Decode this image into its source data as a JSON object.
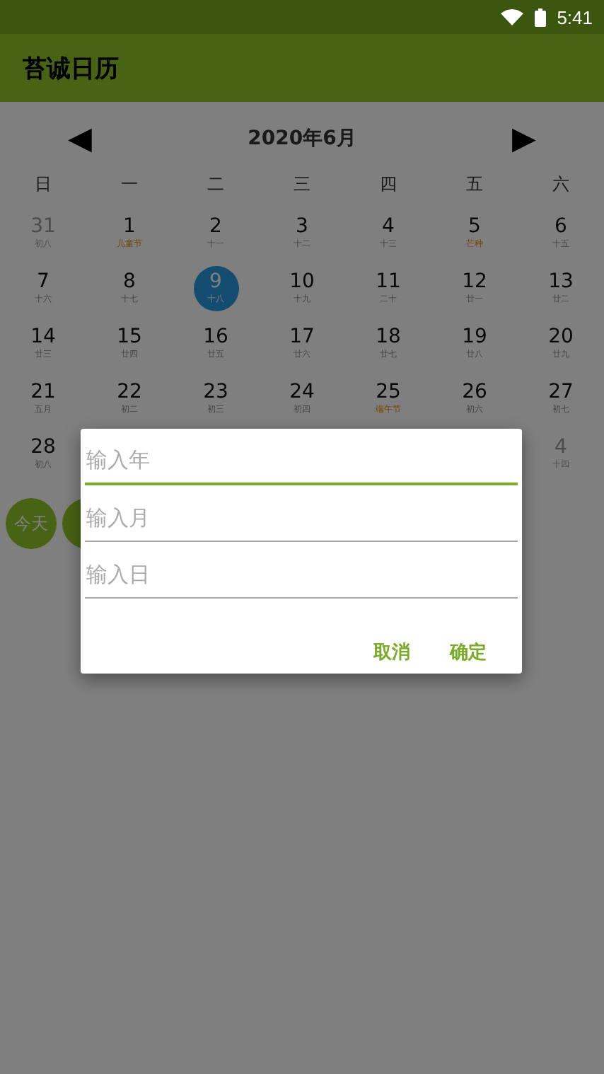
{
  "status_bar": {
    "time": "5:41"
  },
  "app_bar": {
    "title": "苔诚日历"
  },
  "calendar": {
    "month_title": "2020年6月",
    "prev": "◀",
    "next": "▶",
    "weekdays": [
      "日",
      "一",
      "二",
      "三",
      "四",
      "五",
      "六"
    ],
    "hidden_span_last_week": true,
    "weeks": [
      [
        {
          "day": "31",
          "lunar": "初八",
          "other_month": true,
          "festival": false,
          "selected": false
        },
        {
          "day": "1",
          "lunar": "儿童节",
          "other_month": false,
          "festival": true,
          "selected": false
        },
        {
          "day": "2",
          "lunar": "十一",
          "other_month": false,
          "festival": false,
          "selected": false
        },
        {
          "day": "3",
          "lunar": "十二",
          "other_month": false,
          "festival": false,
          "selected": false
        },
        {
          "day": "4",
          "lunar": "十三",
          "other_month": false,
          "festival": false,
          "selected": false
        },
        {
          "day": "5",
          "lunar": "芒种",
          "other_month": false,
          "festival": true,
          "selected": false
        },
        {
          "day": "6",
          "lunar": "十五",
          "other_month": false,
          "festival": false,
          "selected": false
        }
      ],
      [
        {
          "day": "7",
          "lunar": "十六",
          "other_month": false,
          "festival": false,
          "selected": false
        },
        {
          "day": "8",
          "lunar": "十七",
          "other_month": false,
          "festival": false,
          "selected": false
        },
        {
          "day": "9",
          "lunar": "十八",
          "other_month": false,
          "festival": false,
          "selected": true
        },
        {
          "day": "10",
          "lunar": "十九",
          "other_month": false,
          "festival": false,
          "selected": false
        },
        {
          "day": "11",
          "lunar": "二十",
          "other_month": false,
          "festival": false,
          "selected": false
        },
        {
          "day": "12",
          "lunar": "廿一",
          "other_month": false,
          "festival": false,
          "selected": false
        },
        {
          "day": "13",
          "lunar": "廿二",
          "other_month": false,
          "festival": false,
          "selected": false
        }
      ],
      [
        {
          "day": "14",
          "lunar": "廿三",
          "other_month": false,
          "festival": false,
          "selected": false
        },
        {
          "day": "15",
          "lunar": "廿四",
          "other_month": false,
          "festival": false,
          "selected": false
        },
        {
          "day": "16",
          "lunar": "廿五",
          "other_month": false,
          "festival": false,
          "selected": false
        },
        {
          "day": "17",
          "lunar": "廿六",
          "other_month": false,
          "festival": false,
          "selected": false
        },
        {
          "day": "18",
          "lunar": "廿七",
          "other_month": false,
          "festival": false,
          "selected": false
        },
        {
          "day": "19",
          "lunar": "廿八",
          "other_month": false,
          "festival": false,
          "selected": false
        },
        {
          "day": "20",
          "lunar": "廿九",
          "other_month": false,
          "festival": false,
          "selected": false
        }
      ],
      [
        {
          "day": "21",
          "lunar": "五月",
          "other_month": false,
          "festival": false,
          "selected": false
        },
        {
          "day": "22",
          "lunar": "初二",
          "other_month": false,
          "festival": false,
          "selected": false
        },
        {
          "day": "23",
          "lunar": "初三",
          "other_month": false,
          "festival": false,
          "selected": false
        },
        {
          "day": "24",
          "lunar": "初四",
          "other_month": false,
          "festival": false,
          "selected": false
        },
        {
          "day": "25",
          "lunar": "端午节",
          "other_month": false,
          "festival": true,
          "selected": false
        },
        {
          "day": "26",
          "lunar": "初六",
          "other_month": false,
          "festival": false,
          "selected": false
        },
        {
          "day": "27",
          "lunar": "初七",
          "other_month": false,
          "festival": false,
          "selected": false
        }
      ],
      [
        {
          "day": "28",
          "lunar": "初八",
          "other_month": false,
          "festival": false,
          "selected": false
        },
        {
          "day": "4",
          "lunar": "十四",
          "other_month": true,
          "festival": false,
          "selected": false
        }
      ]
    ]
  },
  "round_buttons": [
    {
      "kind": "labeled",
      "label": "今天"
    },
    {
      "kind": "covered"
    }
  ],
  "dialog": {
    "fields": [
      {
        "placeholder": "输入年",
        "focused": true
      },
      {
        "placeholder": "输入月",
        "focused": false
      },
      {
        "placeholder": "输入日",
        "focused": false
      }
    ],
    "buttons": [
      "取消",
      "确定"
    ]
  }
}
